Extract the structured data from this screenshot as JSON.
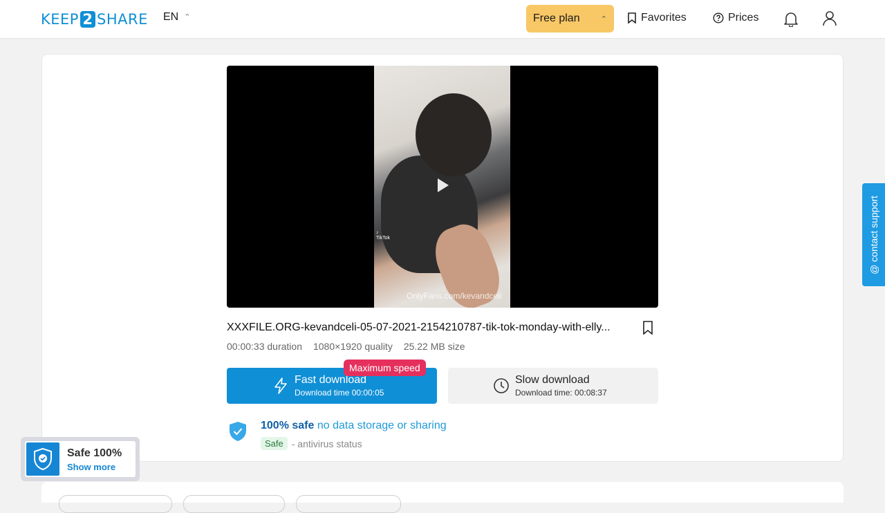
{
  "header": {
    "logo": {
      "left": "KEEP",
      "mid": "2",
      "right": "SHARE"
    },
    "language": "EN",
    "plan_label": "Free plan",
    "favorites_label": "Favorites",
    "prices_label": "Prices"
  },
  "video": {
    "watermark": "OnlyFans.com/kevandceli"
  },
  "file": {
    "name": "XXXFILE.ORG-kevandceli-05-07-2021-2154210787-tik-tok-monday-with-elly...",
    "duration": "00:00:33",
    "duration_label": "duration",
    "quality": "1080×1920",
    "quality_label": "quality",
    "size": "25.22 MB",
    "size_label": "size"
  },
  "download": {
    "badge": "Maximum speed",
    "fast_title": "Fast download",
    "fast_sub": "Download time 00:00:05",
    "slow_title": "Slow download",
    "slow_sub": "Download time: 00:08:37"
  },
  "safety": {
    "bold": "100% safe",
    "rest": "no data storage or sharing",
    "status_pill": "Safe",
    "status_text": "- antivirus status"
  },
  "support_label": "@ contact support",
  "safe_widget": {
    "title": "Safe 100%",
    "link": "Show more"
  },
  "colors": {
    "accent": "#0f8fd6",
    "plan": "#f8c766",
    "badge": "#e5305d",
    "support": "#1e9be3"
  }
}
